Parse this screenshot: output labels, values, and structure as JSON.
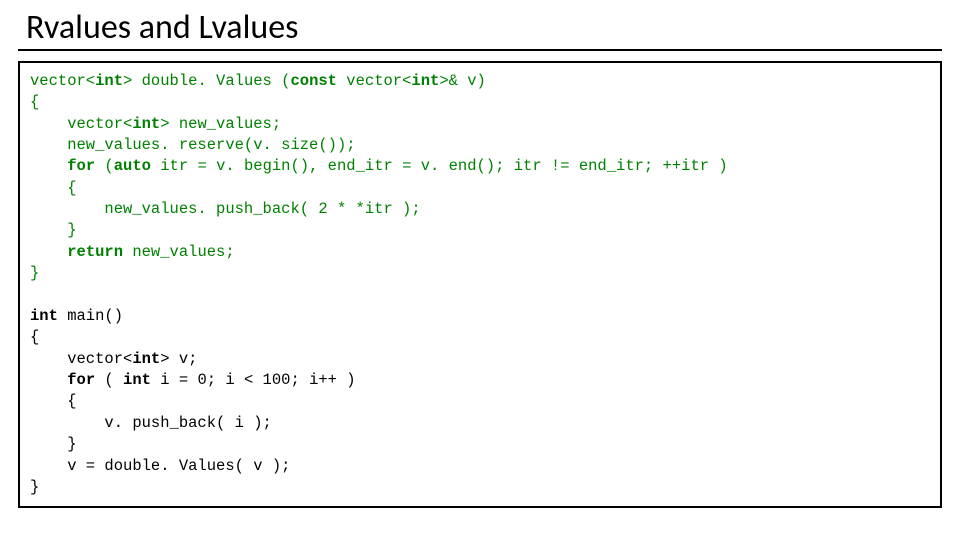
{
  "title": "Rvalues and Lvalues",
  "code": {
    "l01a": "vector<",
    "l01b": "int",
    "l01c": "> double. Values (",
    "l01d": "const",
    "l01e": " vector<",
    "l01f": "int",
    "l01g": ">& v)",
    "l02": "{",
    "l03a": "    vector<",
    "l03b": "int",
    "l03c": "> new_values;",
    "l04": "    new_values. reserve(v. size());",
    "l05a": "    ",
    "l05b": "for",
    "l05c": " (",
    "l05d": "auto",
    "l05e": " itr = v. begin(), end_itr = v. end(); itr != end_itr; ++itr )",
    "l06": "    {",
    "l07": "        new_values. push_back( 2 * *itr );",
    "l08": "    }",
    "l09a": "    ",
    "l09b": "return",
    "l09c": " new_values;",
    "l10": "}",
    "blank": " ",
    "l11a": "int",
    "l11b": " main()",
    "l12": "{",
    "l13a": "    vector<",
    "l13b": "int",
    "l13c": "> v;",
    "l14a": "    ",
    "l14b": "for",
    "l14c": " ( ",
    "l14d": "int",
    "l14e": " i = 0; i < 100; i++ )",
    "l15": "    {",
    "l16": "        v. push_back( i );",
    "l17": "    }",
    "l18": "    v = double. Values( v );",
    "l19": "}"
  }
}
